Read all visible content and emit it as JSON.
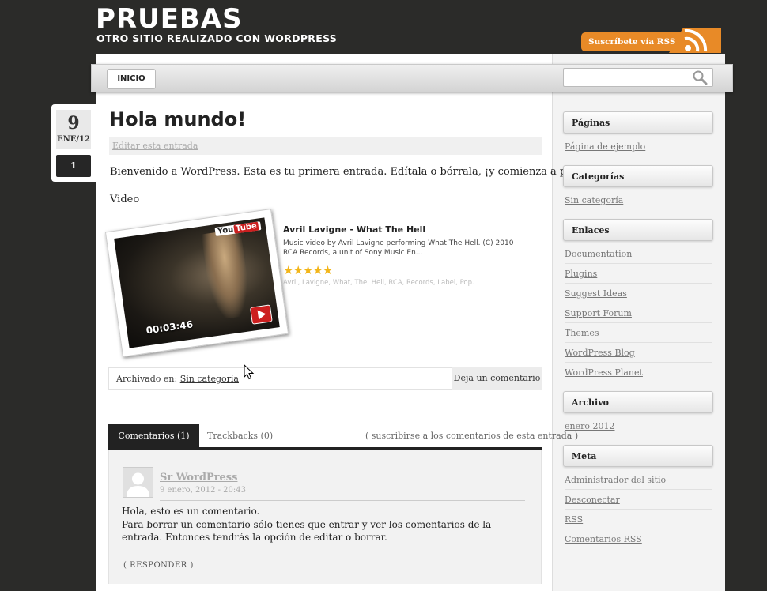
{
  "site": {
    "title": "PRUEBAS",
    "description": "OTRO SITIO REALIZADO CON WORDPRESS",
    "rss_label": "Suscríbete vía RSS"
  },
  "nav": {
    "home_label": "INICIO",
    "search_placeholder": ""
  },
  "post": {
    "date_day": "9",
    "date_month": "ENE/12",
    "comment_count": "1",
    "title": "Hola mundo!",
    "edit_label": "Editar esta entrada",
    "body": "Bienvenido a WordPress. Esta es tu primera entrada. Edítala o bórrala, ¡y comienza a publicar!.",
    "video_label": "Video",
    "archived_prefix": "Archivado en:",
    "category": "Sin categoría",
    "leave_comment": "Deja un comentario"
  },
  "video": {
    "title": "Avril Lavigne - What The Hell",
    "description": "Music video by Avril Lavigne performing What The Hell. (C) 2010 RCA Records, a unit of Sony Music En...",
    "rating_stars": 5,
    "stars_text": "★★★★★",
    "tags": "Avril, Lavigne, What, The, Hell, RCA, Records, Label, Pop.",
    "duration": "00:03:46",
    "badge_you": "You",
    "badge_tube": "Tube"
  },
  "comments_section": {
    "tab_comments": "Comentarios (1)",
    "tab_trackbacks": "Trackbacks (0)",
    "subscribe": "( suscribirse a los comentarios de esta entrada )",
    "comment": {
      "author": "Sr WordPress",
      "date": "9 enero, 2012 - 20:43",
      "line1": "Hola, esto es un comentario.",
      "line2": "Para borrar un comentario sólo tienes que entrar y ver los comentarios de la entrada. Entonces tendrás la opción de editar o borrar.",
      "reply": "( RESPONDER )"
    }
  },
  "sidebar": {
    "pages_heading": "Páginas",
    "pages_links": [
      "Página de ejemplo"
    ],
    "categories_heading": "Categorías",
    "categories_links": [
      "Sin categoría"
    ],
    "links_heading": "Enlaces",
    "links": [
      "Documentation",
      "Plugins",
      "Suggest Ideas",
      "Support Forum",
      "Themes",
      "WordPress Blog",
      "WordPress Planet"
    ],
    "archive_heading": "Archivo",
    "archive_links": [
      "enero 2012"
    ],
    "meta_heading": "Meta",
    "meta_site_admin": "Administrador del sitio",
    "meta_logout": "Desconectar",
    "meta_rss": "RSS",
    "meta_comments_prefix": "Comentarios ",
    "meta_comments_rss": "RSS"
  },
  "colors": {
    "background": "#2b2b29",
    "rss_orange": "#e88a27",
    "tab_active": "#222222",
    "link_grey": "#777777"
  }
}
